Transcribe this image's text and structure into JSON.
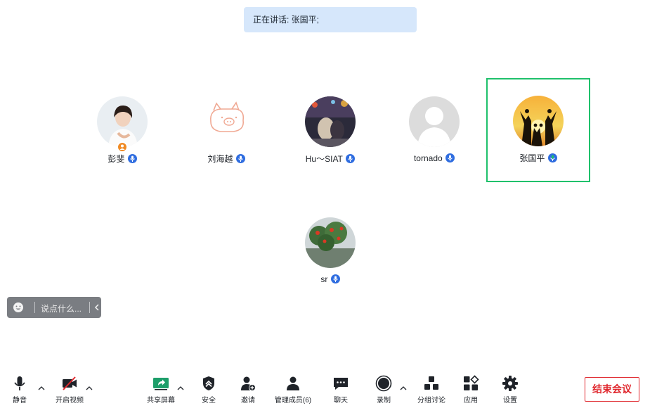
{
  "banner": {
    "speaking_text": "正在讲话: 张国平;"
  },
  "participants": [
    {
      "name": "彭斐",
      "is_host": true,
      "active": false
    },
    {
      "name": "刘海越",
      "is_host": false,
      "active": false
    },
    {
      "name": "Hu～SIAT",
      "is_host": false,
      "active": false
    },
    {
      "name": "tornado",
      "is_host": false,
      "active": false
    },
    {
      "name": "张国平",
      "is_host": false,
      "active": true
    },
    {
      "name": "sr",
      "is_host": false,
      "active": false
    }
  ],
  "chat": {
    "placeholder": "说点什么..."
  },
  "toolbar": {
    "mute": "静音",
    "video": "开启视频",
    "share": "共享屏幕",
    "security": "安全",
    "invite": "邀请",
    "members": "管理成员(6)",
    "chat": "聊天",
    "record": "录制",
    "breakout": "分组讨论",
    "apps": "应用",
    "settings": "设置",
    "end": "结束会议"
  },
  "colors": {
    "accent": "#2f6de0",
    "active_border": "#1fc16b",
    "end_button": "#e0282e",
    "share_green": "#1d9e6a",
    "banner_bg": "#d6e7fb"
  }
}
